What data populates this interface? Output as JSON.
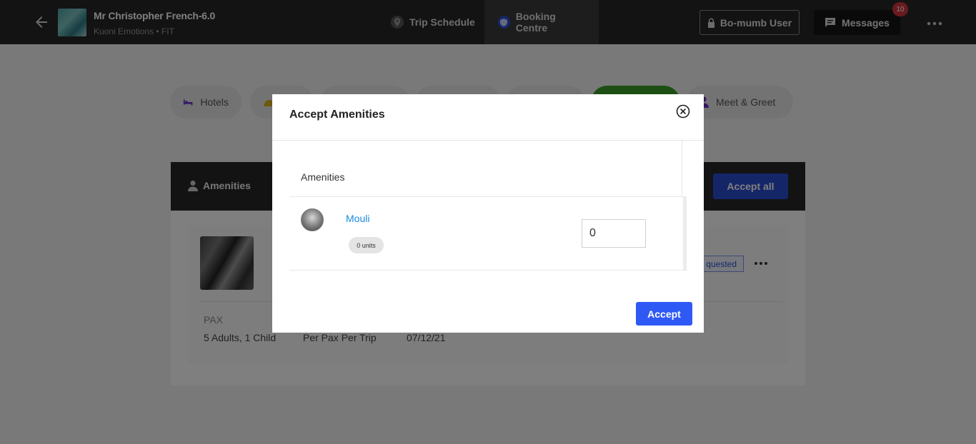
{
  "topbar": {
    "trip_name": "Mr Christopher French-6.0",
    "trip_sub": "Kuoni Emotions • FIT",
    "tabs": [
      {
        "label": "Trip Schedule",
        "icon": "location-pin-icon"
      },
      {
        "label": "Booking Centre",
        "icon": "shield-icon"
      }
    ],
    "user_label": "Bo-mumb User",
    "messages_label": "Messages",
    "messages_count": "10"
  },
  "categories": [
    {
      "label": "Hotels",
      "icon": "bed-icon"
    },
    {
      "label": "Meet & Greet",
      "icon": "person-icon"
    }
  ],
  "panel": {
    "title": "Amenities",
    "accept_all_label": "Accept all",
    "status_badge": "quested",
    "pax_label": "PAX",
    "pax_value": "5 Adults, 1 Child",
    "per_value": "Per Pax Per Trip",
    "date_value": "07/12/21"
  },
  "modal": {
    "title": "Accept Amenities",
    "column_header": "Amenities",
    "item_name": "Mouli",
    "units_label": "0 units",
    "quantity_value": "0",
    "accept_label": "Accept"
  },
  "colors": {
    "topbar": "#262626",
    "accept_blue": "#2f59f5",
    "accept_all_blue": "#2b4dd1",
    "link_blue": "#1a8ae0",
    "badge_red": "#d0353f",
    "green_pill": "#3b9e2a"
  }
}
